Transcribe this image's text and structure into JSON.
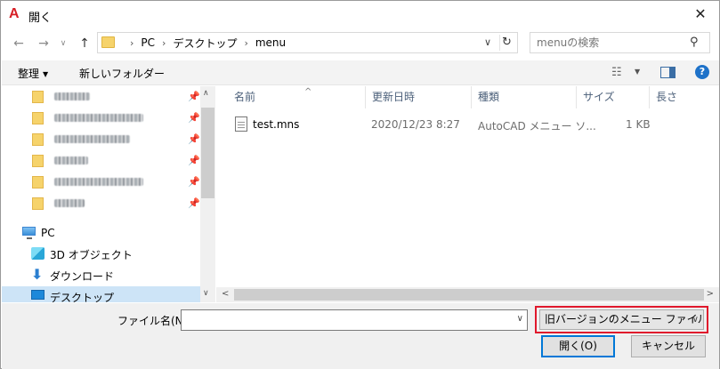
{
  "window": {
    "title": "開く",
    "close_glyph": "✕",
    "app_icon_glyph": "A"
  },
  "nav": {
    "back": "←",
    "forward": "→",
    "recent": "∨",
    "up": "↑"
  },
  "address": {
    "crumbs": [
      "PC",
      "デスクトップ",
      "menu"
    ],
    "separator": "›",
    "dropdown": "∨",
    "refresh": "↻"
  },
  "search": {
    "placeholder": "menuの検索",
    "icon": "⚲"
  },
  "cmdbar": {
    "organize": "整理",
    "organize_arrow": "▼",
    "new_folder": "新しいフォルダー",
    "view_glyph": "☷",
    "view_arrow": "▼",
    "help": "?"
  },
  "navpane": {
    "pin": "📌",
    "pc": "PC",
    "items": [
      {
        "label": "3D オブジェクト"
      },
      {
        "label": "ダウンロード"
      },
      {
        "label": "デスクトップ"
      }
    ],
    "scroll_up": "∧",
    "scroll_down": "∨"
  },
  "filelist": {
    "columns": [
      "名前",
      "更新日時",
      "種類",
      "サイズ",
      "長さ"
    ],
    "sort_glyph": "^",
    "rows": [
      {
        "name": "test.mns",
        "modified": "2020/12/23 8:27",
        "type": "AutoCAD メニュー ソ...",
        "size": "1 KB"
      }
    ],
    "hscroll_left": "<",
    "hscroll_right": ">"
  },
  "bottom": {
    "filename_label": "ファイル名(N):",
    "filename_value": "",
    "filename_drop": "∨",
    "filetype": "旧バージョンのメニュー ファイル(*.mn",
    "filetype_drop": "∨",
    "open_label": "開く(O)",
    "cancel_label": "キャンセル"
  }
}
